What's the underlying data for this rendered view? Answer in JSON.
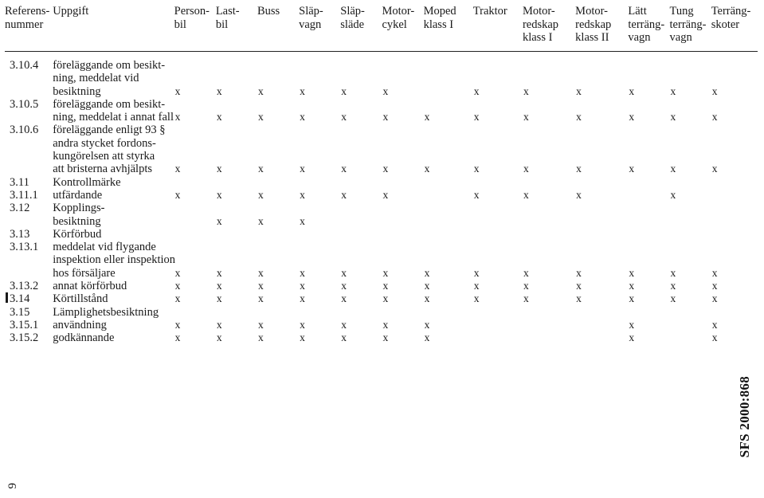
{
  "document": {
    "sfs_label": "SFS 2000:868",
    "page_number": "9"
  },
  "table": {
    "headers": [
      "Referens-\nnummer",
      "Uppgift",
      "Person-\nbil",
      "Last-\nbil",
      "Buss",
      "Släp-\nvagn",
      "Släp-\nsläde",
      "Motor-\ncykel",
      "Moped\nklass I",
      "Traktor",
      "Motor-\nredskap\nklass I",
      "Motor-\nredskap\nklass II",
      "Lätt\nterräng-\nvagn",
      "Tung\nterräng-\nvagn",
      "Terräng-\nskoter"
    ],
    "mark": "x",
    "rows": [
      {
        "ref": "3.10.4",
        "task": "föreläggande om besikt-",
        "marks": []
      },
      {
        "ref": "",
        "task": "ning, meddelat vid",
        "marks": []
      },
      {
        "ref": "",
        "task": "besiktning",
        "marks": [
          1,
          1,
          1,
          1,
          1,
          1,
          0,
          1,
          1,
          1,
          1,
          1,
          1
        ]
      },
      {
        "ref": "3.10.5",
        "task": "föreläggande om besikt-",
        "marks": []
      },
      {
        "ref": "",
        "task": "ning, meddelat i annat fall",
        "marks": [
          1,
          1,
          1,
          1,
          1,
          1,
          1,
          1,
          1,
          1,
          1,
          1,
          1
        ]
      },
      {
        "ref": "3.10.6",
        "task": "föreläggande enligt 93 §",
        "marks": []
      },
      {
        "ref": "",
        "task": "andra stycket fordons-",
        "marks": []
      },
      {
        "ref": "",
        "task": "kungörelsen att styrka",
        "marks": []
      },
      {
        "ref": "",
        "task": "att bristerna avhjälpts",
        "marks": [
          1,
          1,
          1,
          1,
          1,
          1,
          1,
          1,
          1,
          1,
          1,
          1,
          1
        ]
      },
      {
        "ref": "3.11",
        "task": "Kontrollmärke",
        "marks": []
      },
      {
        "ref": "3.11.1",
        "task": "utfärdande",
        "marks": [
          1,
          1,
          1,
          1,
          1,
          1,
          0,
          1,
          1,
          1,
          0,
          1,
          0
        ]
      },
      {
        "ref": "3.12",
        "task": "Kopplings-",
        "marks": []
      },
      {
        "ref": "",
        "task": "besiktning",
        "marks": [
          0,
          1,
          1,
          1,
          0,
          0,
          0,
          0,
          0,
          0,
          0,
          0,
          0
        ]
      },
      {
        "ref": "3.13",
        "task": "Körförbud",
        "marks": []
      },
      {
        "ref": "3.13.1",
        "task": "meddelat vid flygande",
        "marks": []
      },
      {
        "ref": "",
        "task": "inspektion eller inspektion",
        "marks": []
      },
      {
        "ref": "",
        "task": "hos försäljare",
        "marks": [
          1,
          1,
          1,
          1,
          1,
          1,
          1,
          1,
          1,
          1,
          1,
          1,
          1
        ]
      },
      {
        "ref": "3.13.2",
        "task": "annat körförbud",
        "marks": [
          1,
          1,
          1,
          1,
          1,
          1,
          1,
          1,
          1,
          1,
          1,
          1,
          1
        ]
      },
      {
        "ref": "3.14",
        "task": "Körtillstånd",
        "marks": [
          1,
          1,
          1,
          1,
          1,
          1,
          1,
          1,
          1,
          1,
          1,
          1,
          1
        ],
        "changebar": true
      },
      {
        "ref": "3.15",
        "task": "Lämplighetsbesiktning",
        "marks": []
      },
      {
        "ref": "3.15.1",
        "task": "användning",
        "marks": [
          1,
          1,
          1,
          1,
          1,
          1,
          1,
          0,
          0,
          0,
          1,
          0,
          1
        ]
      },
      {
        "ref": "3.15.2",
        "task": "godkännande",
        "marks": [
          1,
          1,
          1,
          1,
          1,
          1,
          1,
          0,
          0,
          0,
          1,
          0,
          1
        ]
      }
    ]
  }
}
